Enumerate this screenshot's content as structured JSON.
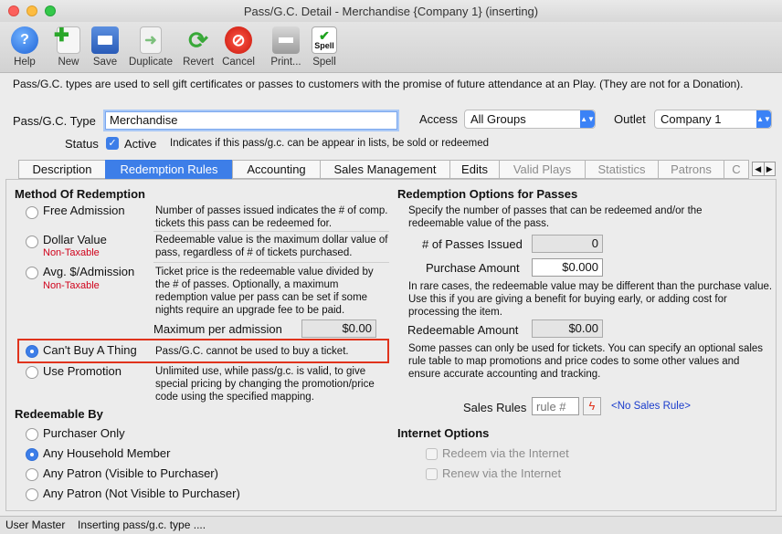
{
  "window": {
    "title": "Pass/G.C. Detail - Merchandise {Company 1} (inserting)"
  },
  "toolbar": {
    "help": "Help",
    "new": "New",
    "save": "Save",
    "duplicate": "Duplicate",
    "revert": "Revert",
    "cancel": "Cancel",
    "print": "Print...",
    "spell": "Spell",
    "spell_icon_text": "Spell"
  },
  "info_text": "Pass/G.C. types are used to sell gift certificates or passes to customers with the promise of future attendance at an Play.  (They are not for a Donation).",
  "form": {
    "type_label": "Pass/G.C. Type",
    "type_value": "Merchandise",
    "access_label": "Access",
    "access_value": "All Groups",
    "outlet_label": "Outlet",
    "outlet_value": "Company 1",
    "status_label": "Status",
    "active_label": "Active",
    "active_desc": "Indicates if this pass/g.c. can be appear in lists, be sold or redeemed"
  },
  "tabs": [
    {
      "label": "Description"
    },
    {
      "label": "Redemption Rules"
    },
    {
      "label": "Accounting"
    },
    {
      "label": "Sales Management"
    },
    {
      "label": "Edits"
    },
    {
      "label": "Valid Plays"
    },
    {
      "label": "Statistics"
    },
    {
      "label": "Patrons"
    },
    {
      "label": "C"
    }
  ],
  "method": {
    "heading": "Method Of Redemption",
    "free_label": "Free Admission",
    "free_desc": "Number of passes issued indicates the # of comp. tickets this pass can be redeemed for.",
    "dollar_label": "Dollar Value",
    "dollar_tax": "Non-Taxable",
    "dollar_desc": "Redeemable value is the maximum dollar value of pass, regardless of # of tickets purchased.",
    "avg_label": "Avg. $/Admission",
    "avg_tax": "Non-Taxable",
    "avg_desc": "Ticket price is the redeemable value divided by the # of passes.  Optionally, a maximum redemption value per pass can be set if some nights require an upgrade fee to be paid.",
    "max_label": "Maximum per admission",
    "max_value": "$0.00",
    "cant_label": "Can't Buy A Thing",
    "cant_desc": "Pass/G.C. cannot be used to buy a ticket.",
    "promo_label": "Use Promotion",
    "promo_desc": "Unlimited use, while pass/g.c. is valid, to give special pricing by changing the promotion/price code using the specified mapping."
  },
  "redeemable_by": {
    "heading": "Redeemable By",
    "opt1": "Purchaser Only",
    "opt2": "Any Household Member",
    "opt3": "Any Patron (Visible to Purchaser)",
    "opt4": "Any Patron (Not Visible to Purchaser)"
  },
  "options": {
    "heading": "Redemption Options for Passes",
    "desc1": "Specify the number of passes that can be redeemed and/or the redeemable value of the pass.",
    "issued_label": "# of Passes Issued",
    "issued_value": "0",
    "purchase_label": "Purchase Amount",
    "purchase_value": "$0.000",
    "desc2": "In rare cases, the redeemable value may be different than the purchase value.  Use this if you are giving a benefit for buying early, or adding cost for processing the item.",
    "redeemable_label": "Redeemable Amount",
    "redeemable_value": "$0.00",
    "desc3": "Some passes can only be used for tickets.  You can specify an optional sales rule table to map promotions and price codes to some other values and ensure accurate accounting and tracking.",
    "sales_rules_label": "Sales Rules",
    "sales_rules_placeholder": "rule #",
    "no_sales_rule": "<No Sales Rule>"
  },
  "internet": {
    "heading": "Internet Options",
    "redeem": "Redeem via the Internet",
    "renew": "Renew via the Internet"
  },
  "status_bar": {
    "user": "User Master",
    "message": "Inserting pass/g.c. type ...."
  },
  "colors": {
    "accent": "#3d7ee8",
    "highlight": "#e0331c",
    "link": "#1a3ccc",
    "warning": "#d0021b"
  }
}
